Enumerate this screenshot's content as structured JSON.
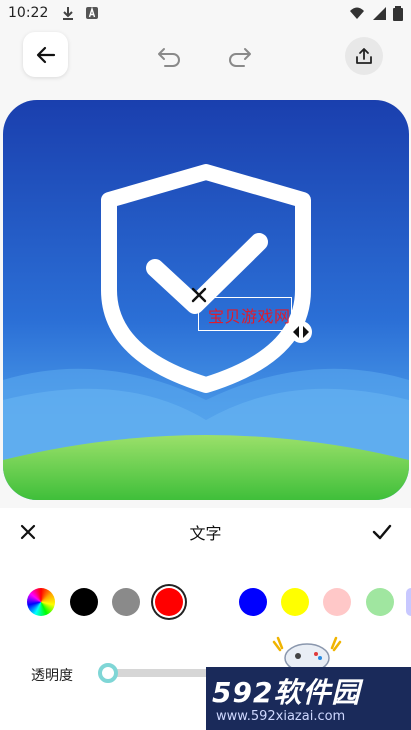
{
  "status_bar": {
    "time": "10:22",
    "left_icons": [
      "download-icon",
      "keyboard-a-icon"
    ],
    "right_icons": [
      "wifi-icon",
      "signal-icon",
      "battery-icon"
    ]
  },
  "toolbar": {
    "back_icon": "arrow-left-icon",
    "undo_icon": "undo-icon",
    "redo_icon": "redo-icon",
    "share_icon": "share-upload-icon"
  },
  "canvas": {
    "overlay_text": "宝贝游戏网",
    "overlay_text_color": "#e01b2c",
    "close_icon": "close-icon",
    "resize_icon": "resize-handle-icon"
  },
  "panel": {
    "title": "文字",
    "close_icon": "close-icon",
    "confirm_icon": "check-icon",
    "colors": [
      "rainbow",
      "#000000",
      "#8a8a8a",
      "#ff0000",
      "#0000ff",
      "#ffff00",
      "#ffc8c8",
      "#a0e6a0"
    ],
    "selected_color": "#ff0000",
    "opacity_label": "透明度",
    "opacity_value": 0.0
  },
  "watermark": {
    "title": "592软件园",
    "url": "www.592xiazai.com"
  }
}
